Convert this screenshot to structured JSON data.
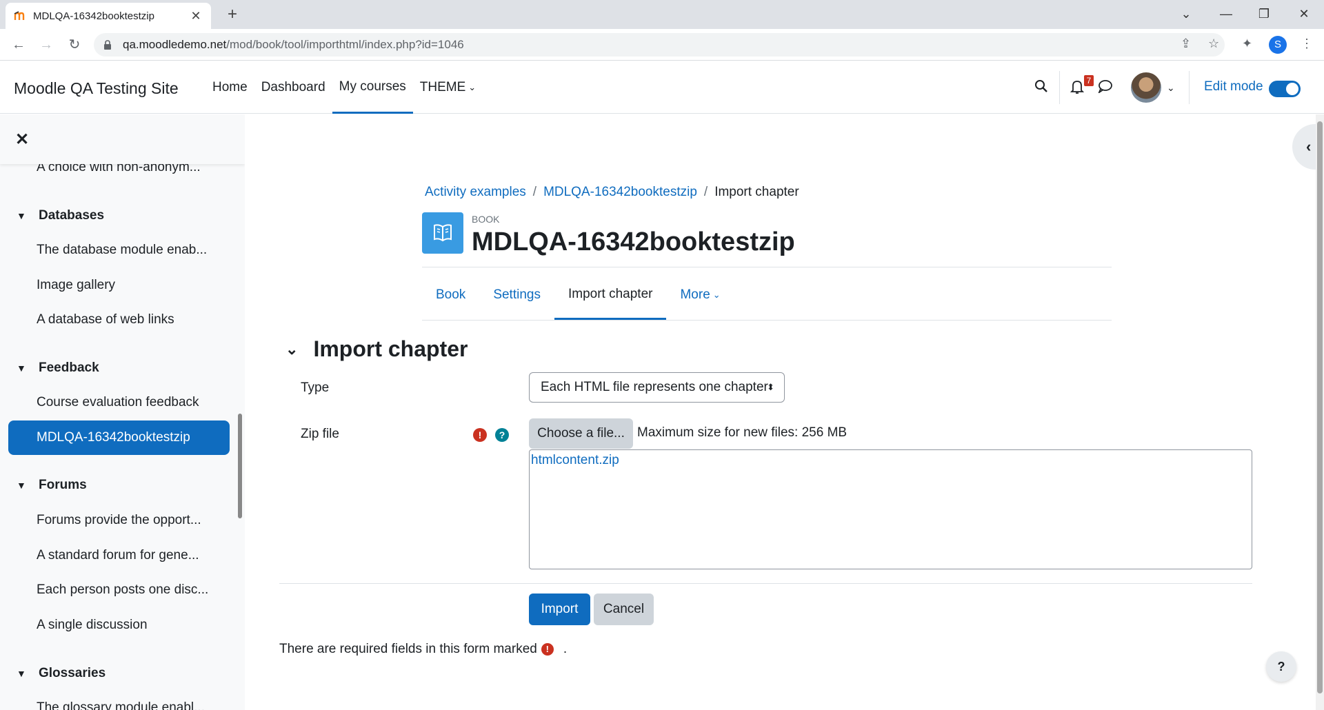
{
  "browser": {
    "tab_title": "MDLQA-16342booktestzip",
    "url_host": "qa.moodledemo.net",
    "url_path": "/mod/book/tool/importhtml/index.php?id=1046",
    "profile_initial": "S"
  },
  "navbar": {
    "site_name": "Moodle QA Testing Site",
    "items": [
      "Home",
      "Dashboard",
      "My courses",
      "THEME"
    ],
    "active_item": "My courses",
    "notification_count": "7",
    "edit_mode_label": "Edit mode",
    "edit_mode_on": true
  },
  "drawer": {
    "items": [
      {
        "type": "item",
        "label": "A choice with non-anonym..."
      },
      {
        "type": "section",
        "label": "Databases"
      },
      {
        "type": "item",
        "label": "The database module enab..."
      },
      {
        "type": "item",
        "label": "Image gallery"
      },
      {
        "type": "item",
        "label": "A database of web links"
      },
      {
        "type": "section",
        "label": "Feedback"
      },
      {
        "type": "item",
        "label": "Course evaluation feedback"
      },
      {
        "type": "active",
        "label": "MDLQA-16342booktestzip"
      },
      {
        "type": "section",
        "label": "Forums"
      },
      {
        "type": "item",
        "label": "Forums provide the opport..."
      },
      {
        "type": "item",
        "label": "A standard forum for gene..."
      },
      {
        "type": "item",
        "label": "Each person posts one disc..."
      },
      {
        "type": "item",
        "label": "A single discussion"
      },
      {
        "type": "section",
        "label": "Glossaries"
      },
      {
        "type": "item",
        "label": "The glossary module enabl..."
      }
    ]
  },
  "breadcrumb": [
    "Activity examples",
    "MDLQA-16342booktestzip",
    "Import chapter"
  ],
  "header": {
    "module_type": "BOOK",
    "title": "MDLQA-16342booktestzip"
  },
  "secondary_nav": {
    "items": [
      "Book",
      "Settings",
      "Import chapter",
      "More"
    ],
    "active": "Import chapter"
  },
  "form": {
    "legend": "Import chapter",
    "type_label": "Type",
    "type_value": "Each HTML file represents one chapter",
    "zip_label": "Zip file",
    "choose_button": "Choose a file...",
    "max_size": "Maximum size for new files: 256 MB",
    "file_name": "htmlcontent.zip",
    "import_button": "Import",
    "cancel_button": "Cancel",
    "required_note": "There are required fields in this form marked",
    "required_note_end": "."
  },
  "colors": {
    "primary": "#0f6cbf",
    "required": "#ca3120",
    "help": "#008196",
    "module_icon": "#399be2"
  }
}
